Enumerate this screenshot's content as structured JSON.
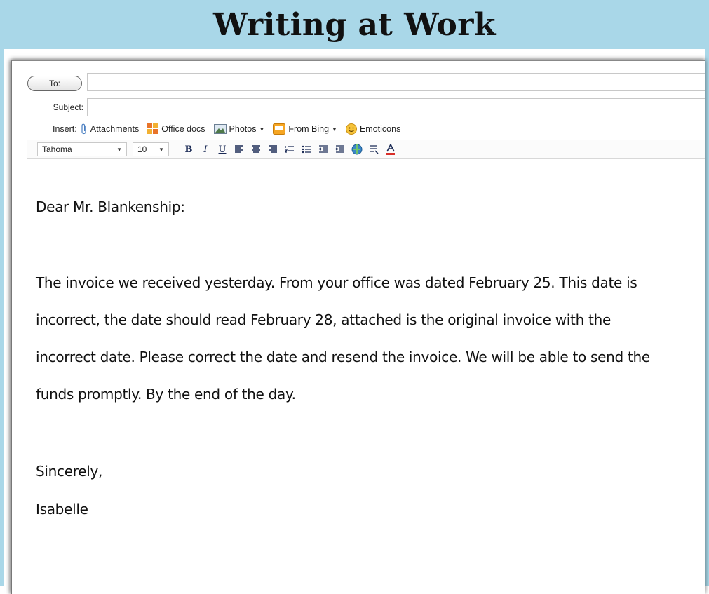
{
  "banner": {
    "title": "Writing at Work"
  },
  "compose": {
    "to_label": "To:",
    "to_value": "",
    "subject_label": "Subject:",
    "subject_value": "",
    "insert_label": "Insert:",
    "insert_items": [
      {
        "label": "Attachments",
        "icon": "paperclip-icon"
      },
      {
        "label": "Office docs",
        "icon": "office-docs-icon"
      },
      {
        "label": "Photos",
        "icon": "photos-icon"
      },
      {
        "label": "From Bing",
        "icon": "bing-icon"
      },
      {
        "label": "Emoticons",
        "icon": "emoticon-icon"
      }
    ],
    "font": "Tahoma",
    "font_size": "10",
    "format_buttons": [
      "bold",
      "italic",
      "underline",
      "align-left",
      "align-center",
      "align-right",
      "numbered-list",
      "bulleted-list",
      "decrease-indent",
      "increase-indent",
      "insert-link",
      "highlight",
      "font-color"
    ]
  },
  "letter": {
    "greeting": "Dear Mr. Blankenship:",
    "p1": "The invoice we received yesterday. From your office was dated February 25.  This date is",
    "p2": "incorrect, the date should read February 28, attached is the original invoice with the",
    "p3": "incorrect date. Please correct the date and resend the invoice. We will be able to send the",
    "p4": "funds promptly. By the end of the day.",
    "closing": "Sincerely,",
    "signature": "Isabelle"
  }
}
